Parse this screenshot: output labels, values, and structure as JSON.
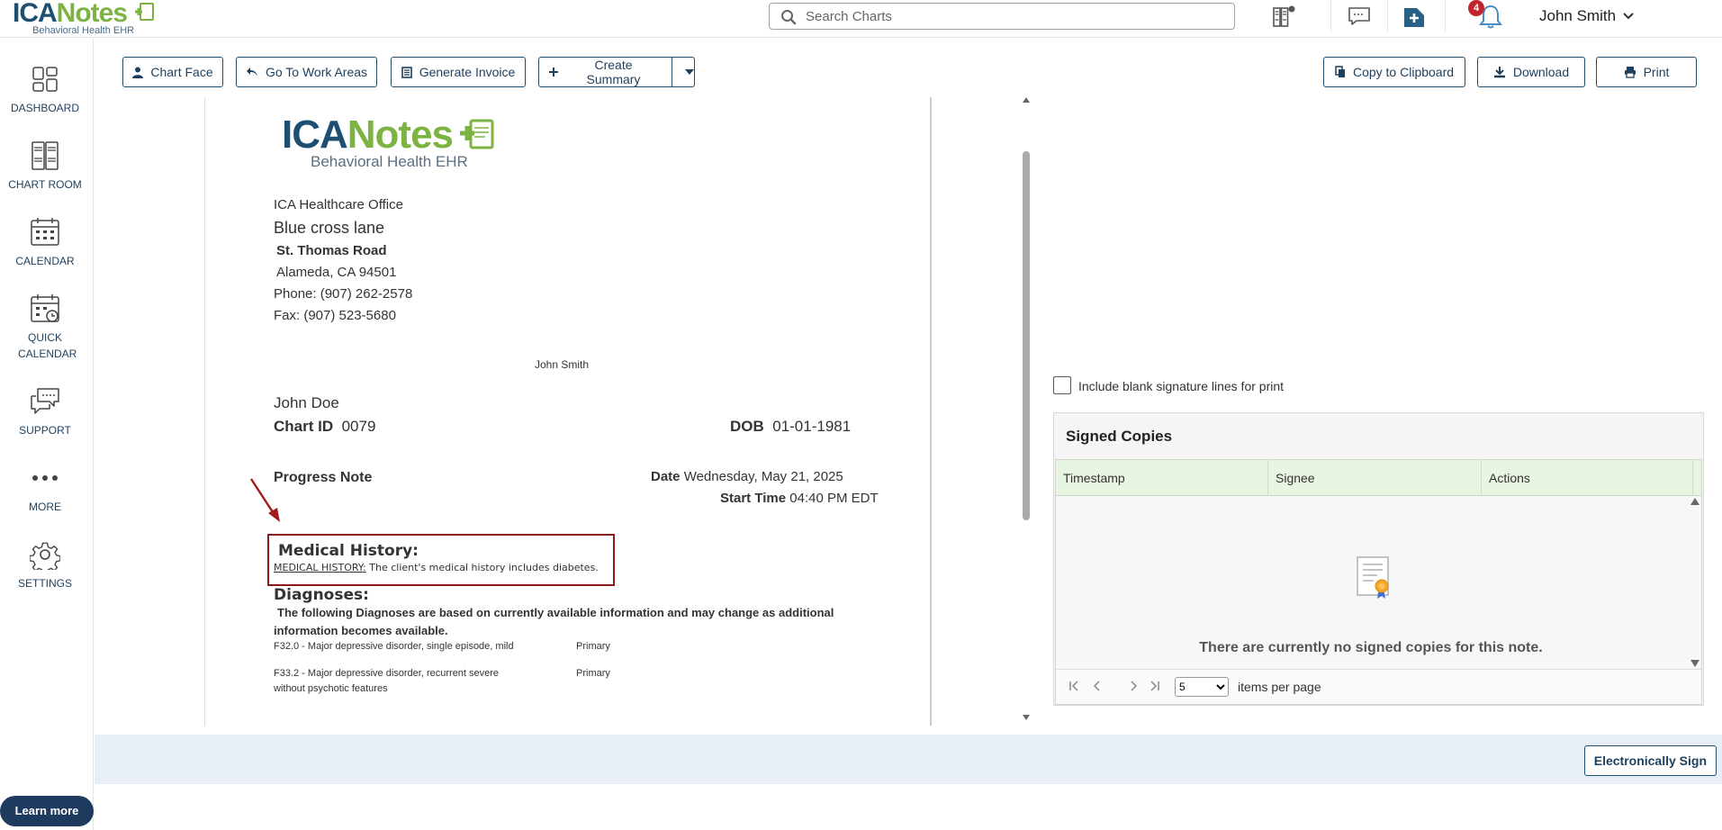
{
  "app": {
    "logo_word_a": "ICA",
    "logo_word_b": "Notes",
    "logo_sub": "Behavioral Health EHR"
  },
  "header": {
    "search_placeholder": "Search Charts",
    "notification_count": "4",
    "user_name": "John Smith"
  },
  "nav": {
    "items": [
      {
        "label": "DASHBOARD",
        "icon": "dashboard-icon"
      },
      {
        "label": "CHART ROOM",
        "icon": "chart-room-icon"
      },
      {
        "label": "CALENDAR",
        "icon": "calendar-icon"
      },
      {
        "label": "QUICK CALENDAR",
        "icon": "quick-calendar-icon"
      },
      {
        "label": "SUPPORT",
        "icon": "support-icon"
      },
      {
        "label": "MORE",
        "icon": "more-icon"
      },
      {
        "label": "SETTINGS",
        "icon": "settings-icon"
      }
    ],
    "learn_more": "Learn more"
  },
  "toolbar": {
    "chart_face": "Chart Face",
    "go_to_work_areas": "Go To Work Areas",
    "generate_invoice": "Generate Invoice",
    "create_summary": "Create Summary",
    "copy_to_clipboard": "Copy to Clipboard",
    "download": "Download",
    "print": "Print"
  },
  "document": {
    "office_name": "ICA Healthcare Office",
    "address_line1": "Blue cross lane",
    "address_line2": "St. Thomas Road",
    "address_line3": "Alameda, CA 94501",
    "phone": "Phone: (907) 262-2578",
    "fax": "Fax: (907) 523-5680",
    "provider": "John Smith",
    "patient_name": "John Doe",
    "chart_id_label": "Chart ID",
    "chart_id": "0079",
    "dob_label": "DOB",
    "dob": "01-01-1981",
    "note_type": "Progress Note",
    "date_label": "Date",
    "date": "Wednesday, May 21, 2025",
    "start_time_label": "Start Time",
    "start_time": "04:40 PM EDT",
    "medical_history_heading": "Medical History:",
    "medical_history_label": "MEDICAL HISTORY:",
    "medical_history_text": "The client's medical history includes diabetes.",
    "diagnoses_heading": "Diagnoses:",
    "diagnoses_intro_1": "The following Diagnoses are based on currently available information and may change as additional",
    "diagnoses_intro_2": "information becomes available.",
    "diagnoses": [
      {
        "line1": "F32.0 - Major depressive disorder, single episode, mild",
        "line2": "",
        "type": "Primary"
      },
      {
        "line1": "F33.2 - Major depressive disorder, recurrent severe",
        "line2": "without psychotic features",
        "type": "Primary"
      }
    ]
  },
  "right_panel": {
    "include_blank_sig": "Include blank signature lines for print",
    "signed_copies_title": "Signed Copies",
    "columns": [
      "Timestamp",
      "Signee",
      "Actions"
    ],
    "empty_message": "There are currently no signed copies for this note.",
    "page_size": "5",
    "items_per_page": "items per page"
  },
  "footer": {
    "electronically_sign": "Electronically Sign"
  },
  "colors": {
    "brand_navy": "#1d4f73",
    "brand_green": "#7cb342",
    "highlight_red": "#8b1a1a",
    "grid_header": "#e8f5e0"
  }
}
